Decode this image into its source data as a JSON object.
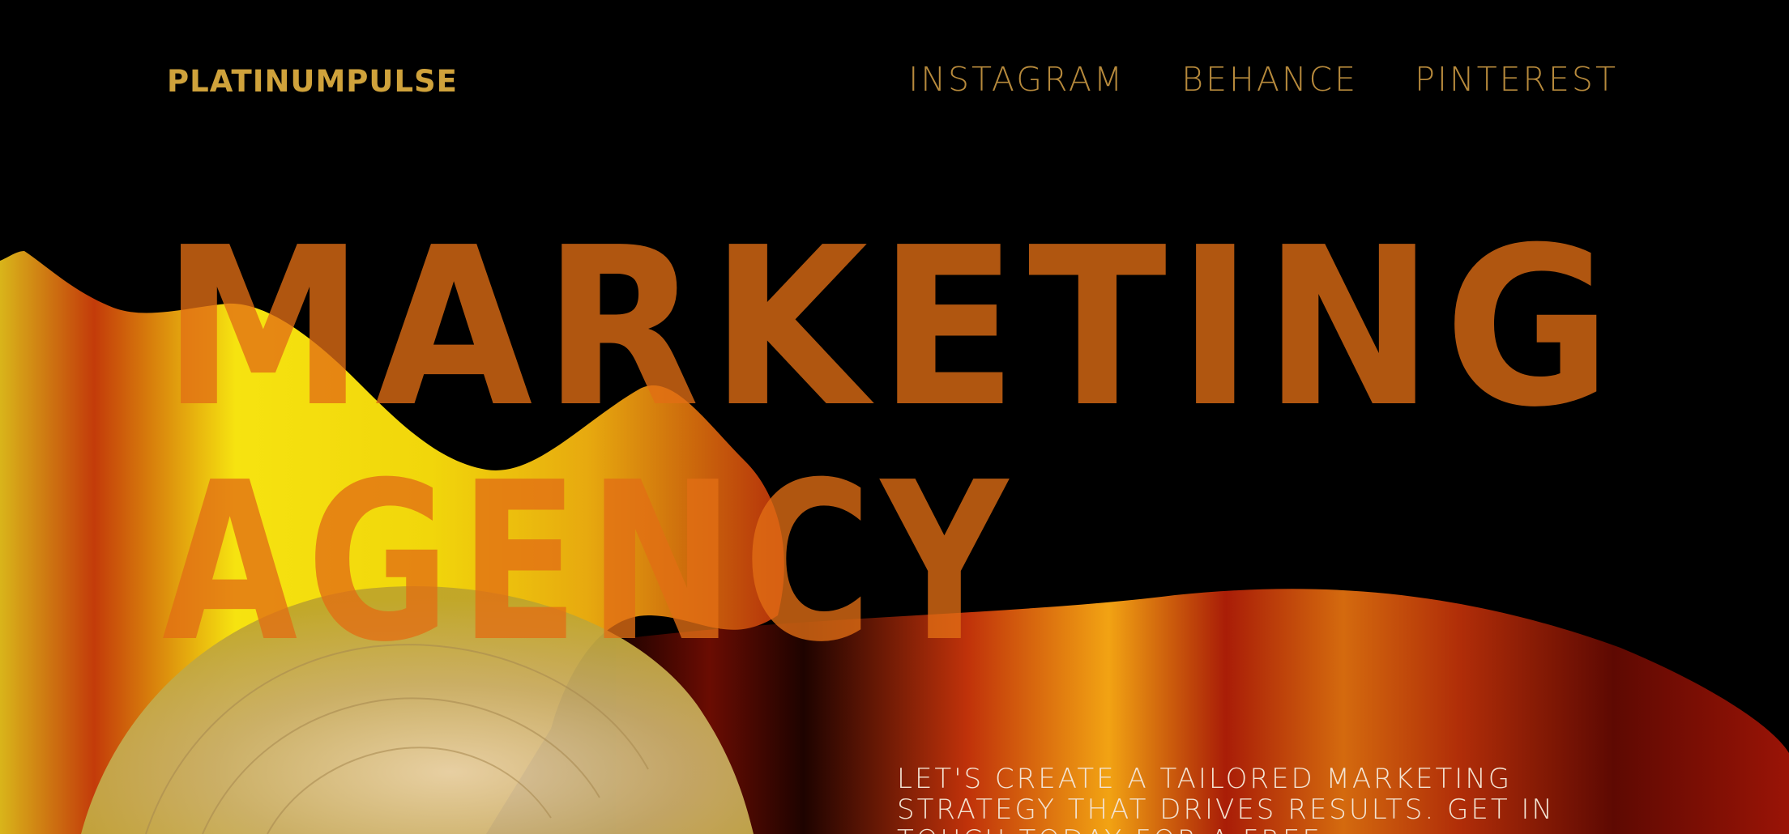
{
  "header": {
    "brand": "PLATINUMPULSE",
    "nav": [
      {
        "label": "INSTAGRAM"
      },
      {
        "label": "BEHANCE"
      },
      {
        "label": "PINTEREST"
      }
    ]
  },
  "hero": {
    "headline_line1": "MARKETING",
    "headline_line2": "AGENCY",
    "tagline": "LET'S CREATE A TAILORED MARKETING STRATEGY THAT DRIVES RESULTS. GET IN TOUCH TODAY FOR A FREE"
  },
  "colors": {
    "background": "#000000",
    "brand": "#cfa23b",
    "nav": "#b78a3c",
    "headline": "#e06e14",
    "tagline": "#f3e3d2",
    "gradient_yellow": "#f2df10",
    "gradient_orange": "#f08a0e",
    "gradient_red": "#b81e0a",
    "gradient_green": "#3a9a1e"
  }
}
